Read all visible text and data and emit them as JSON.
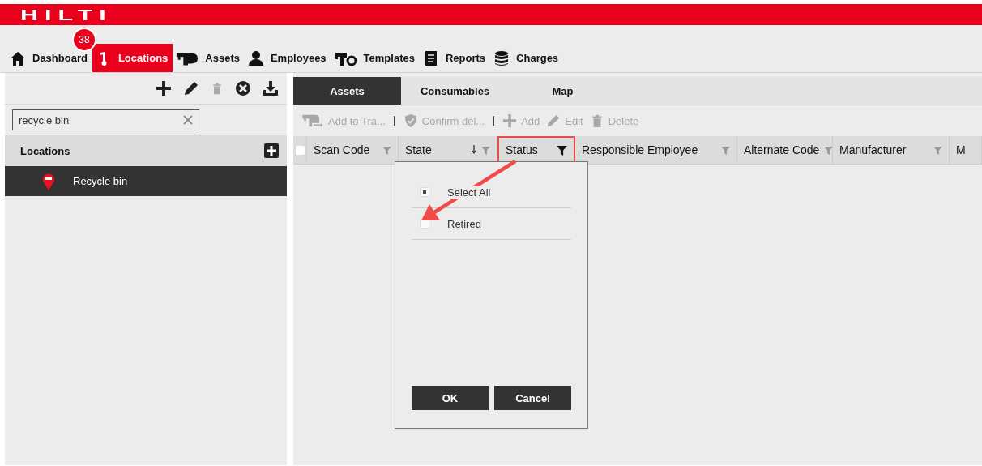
{
  "brand": {
    "logo": "HILTI"
  },
  "nav": [
    {
      "label": "Dashboard",
      "selected": false
    },
    {
      "label": "Locations",
      "selected": true,
      "badge": "38"
    },
    {
      "label": "Assets",
      "selected": false
    },
    {
      "label": "Employees",
      "selected": false
    },
    {
      "label": "Templates",
      "selected": false
    },
    {
      "label": "Reports",
      "selected": false
    },
    {
      "label": "Charges",
      "selected": false
    }
  ],
  "sidebar": {
    "tools": [
      {
        "disabled": false
      },
      {
        "disabled": false
      },
      {
        "disabled": true
      },
      {
        "disabled": false
      },
      {
        "disabled": false
      }
    ],
    "search": {
      "value": "recycle bin"
    },
    "tree_header": "Locations",
    "items": [
      {
        "label": "Recycle bin",
        "selected": true
      }
    ]
  },
  "tabs": [
    {
      "label": "Assets",
      "selected": true
    },
    {
      "label": "Consumables",
      "selected": false
    },
    {
      "label": "Map",
      "selected": false
    }
  ],
  "toolbar": [
    {
      "label": "Add to Tra...",
      "disabled": true,
      "separator": true
    },
    {
      "label": "Confirm del...",
      "disabled": true,
      "separator": true
    },
    {
      "label": "Add",
      "disabled": true,
      "separator": false
    },
    {
      "label": "Edit",
      "disabled": true,
      "separator": false
    },
    {
      "label": "Delete",
      "disabled": true,
      "separator": false
    }
  ],
  "table": {
    "all_checked": false,
    "columns": [
      {
        "label": "Scan Code",
        "filtered": false,
        "sorted": false,
        "highlighted": false
      },
      {
        "label": "State",
        "filtered": false,
        "sorted": true,
        "highlighted": false
      },
      {
        "label": "Status",
        "filtered": true,
        "sorted": false,
        "highlighted": true
      },
      {
        "label": "Responsible Employee",
        "filtered": false,
        "sorted": false,
        "highlighted": false
      },
      {
        "label": "Alternate Code",
        "filtered": false,
        "sorted": false,
        "highlighted": false
      },
      {
        "label": "Manufacturer",
        "filtered": false,
        "sorted": false,
        "highlighted": false
      },
      {
        "label": "M",
        "sorted": false,
        "highlighted": false
      }
    ]
  },
  "filter_popup": {
    "options": [
      {
        "label": "Select All",
        "partial": true
      },
      {
        "label": "Retired",
        "partial": false
      }
    ],
    "buttons": [
      "OK",
      "Cancel"
    ]
  }
}
